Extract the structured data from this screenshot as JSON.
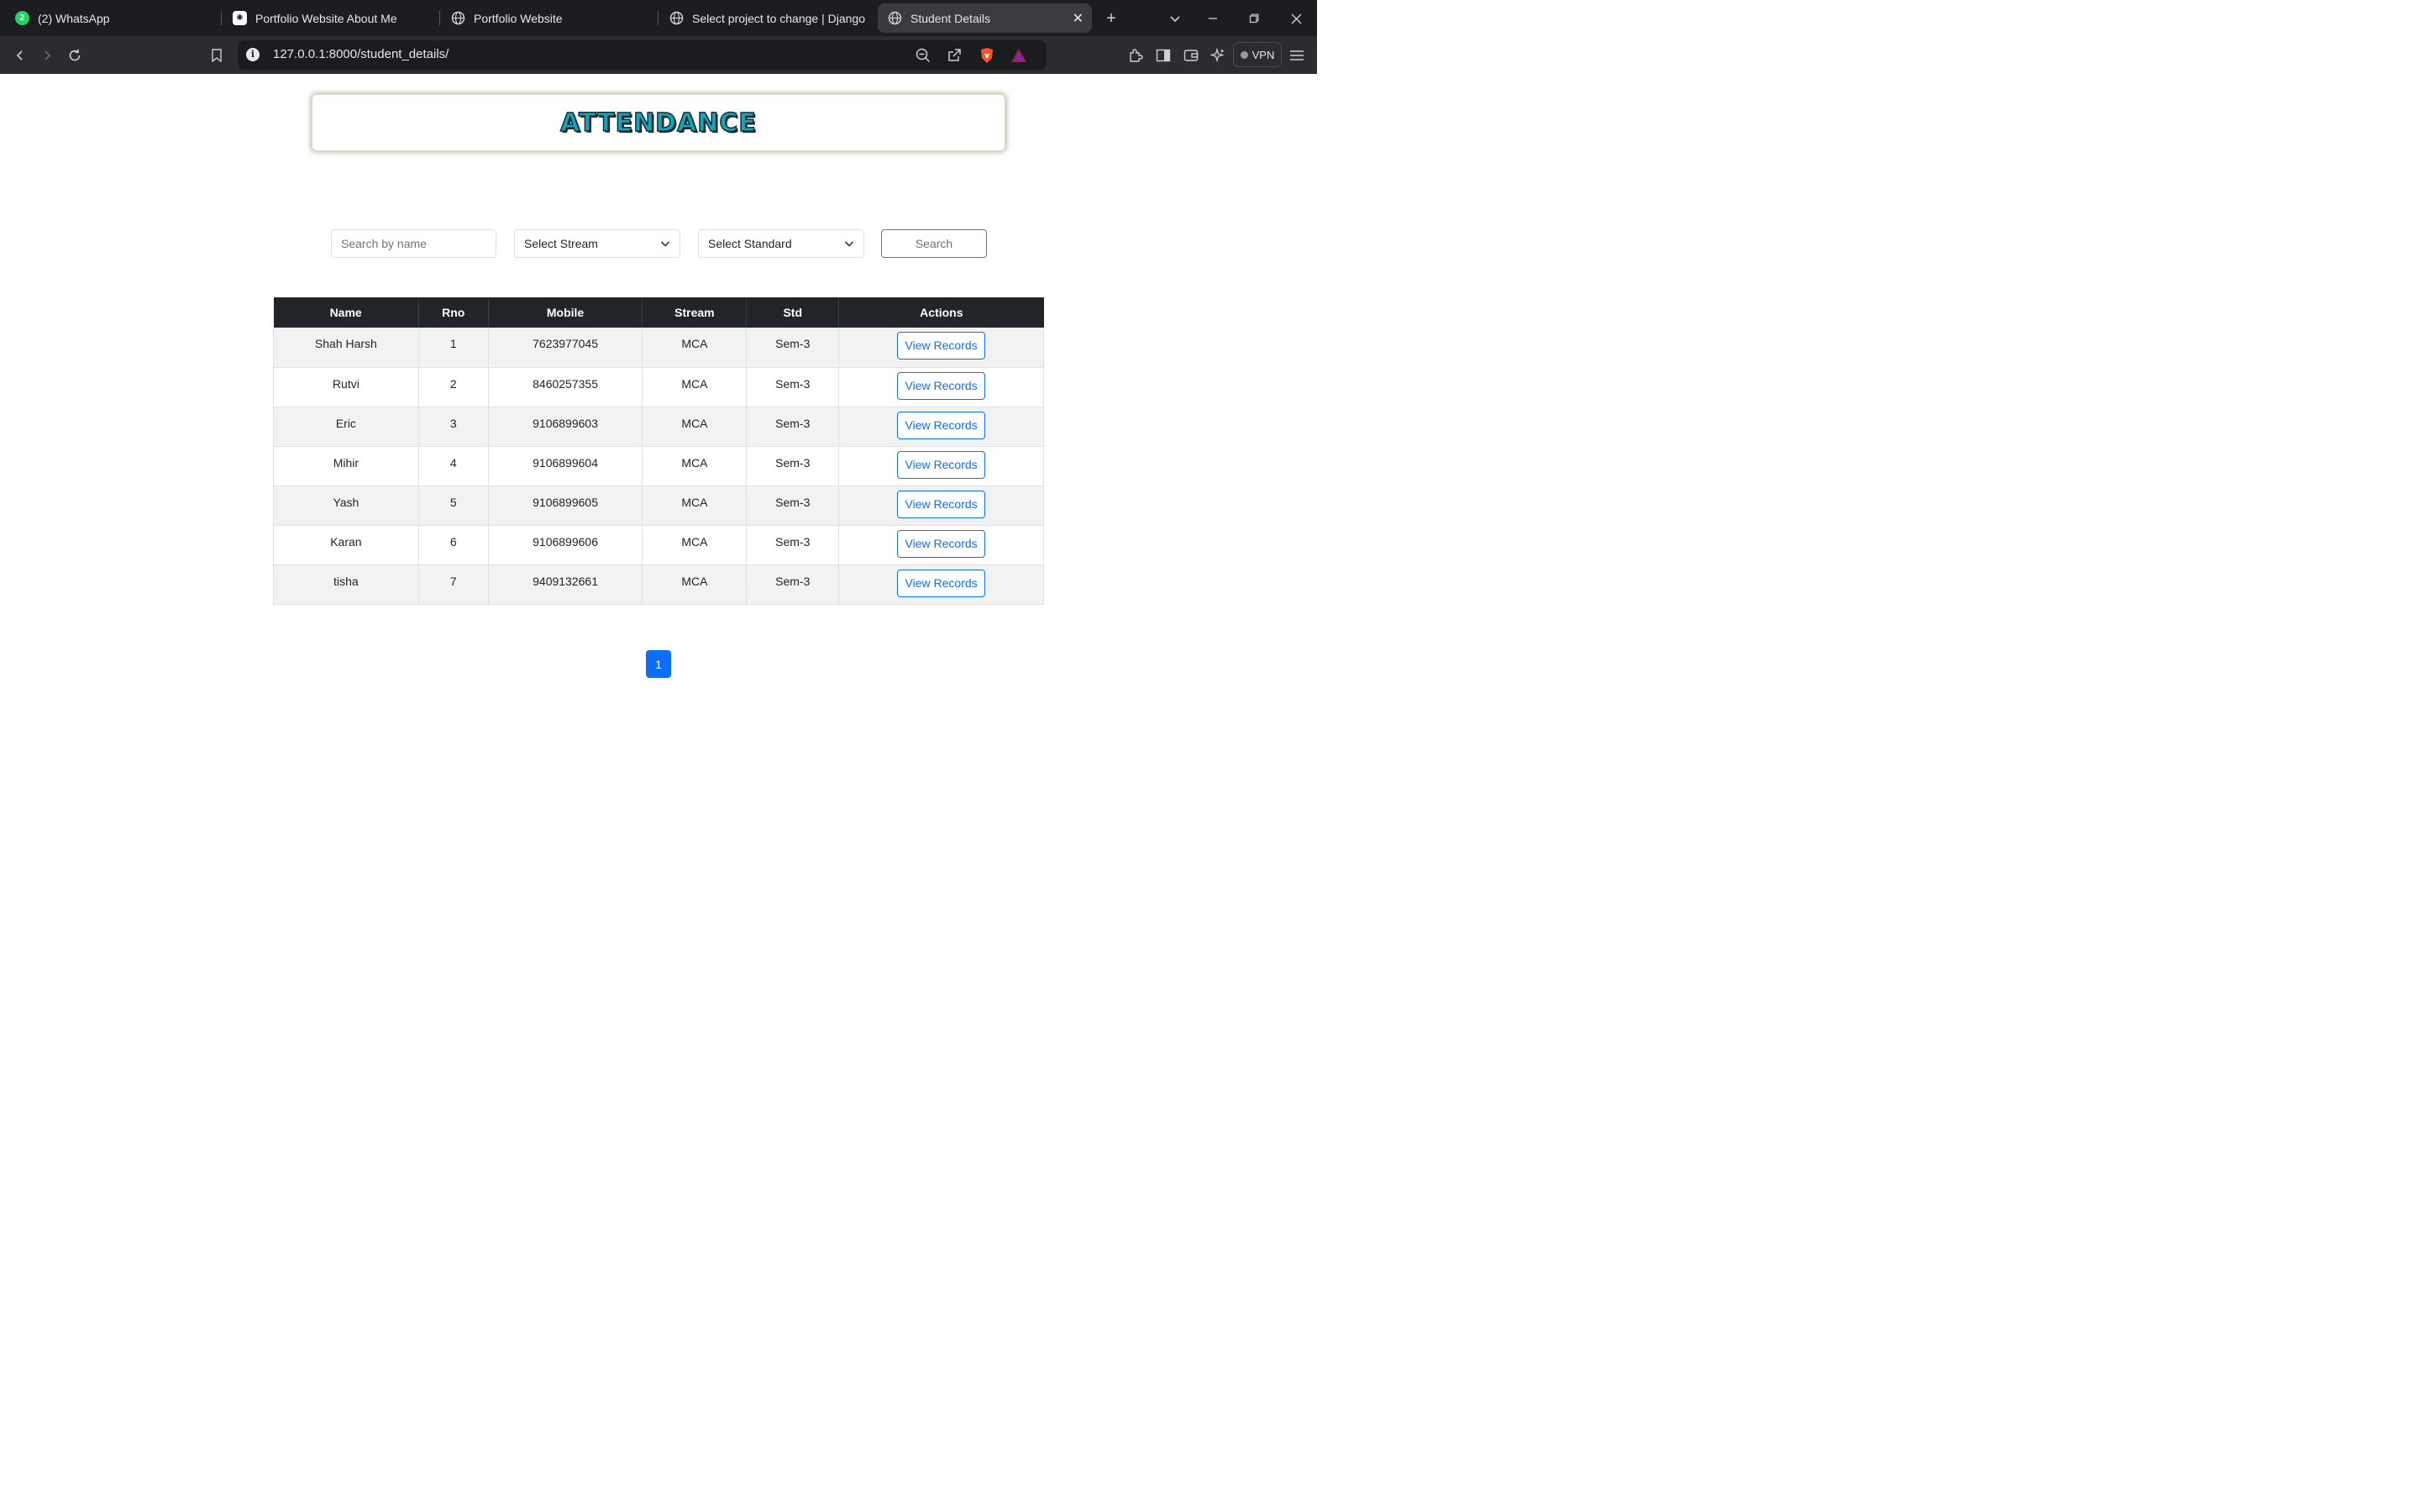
{
  "browser": {
    "tabs": [
      {
        "title": "(2) WhatsApp",
        "badge": "2",
        "icon": "whatsapp-icon"
      },
      {
        "title": "Portfolio Website About Me",
        "icon": "openai-icon"
      },
      {
        "title": "Portfolio Website",
        "icon": "globe-icon"
      },
      {
        "title": "Select project to change | Django sit",
        "icon": "globe-icon"
      },
      {
        "title": "Student Details",
        "icon": "globe-icon",
        "active": true
      }
    ],
    "url": "127.0.0.1:8000/student_details/",
    "vpn_label": "VPN"
  },
  "page": {
    "logo_text": "ATTENDANCE",
    "search": {
      "placeholder": "Search by name",
      "stream_label": "Select Stream",
      "standard_label": "Select Standard",
      "button_label": "Search"
    },
    "table": {
      "headers": [
        "Name",
        "Rno",
        "Mobile",
        "Stream",
        "Std",
        "Actions"
      ],
      "rows": [
        {
          "name": "Shah Harsh",
          "rno": "1",
          "mobile": "7623977045",
          "stream": "MCA",
          "std": "Sem-3",
          "action": "View Records"
        },
        {
          "name": "Rutvi",
          "rno": "2",
          "mobile": "8460257355",
          "stream": "MCA",
          "std": "Sem-3",
          "action": "View Records"
        },
        {
          "name": "Eric",
          "rno": "3",
          "mobile": "9106899603",
          "stream": "MCA",
          "std": "Sem-3",
          "action": "View Records"
        },
        {
          "name": "Mihir",
          "rno": "4",
          "mobile": "9106899604",
          "stream": "MCA",
          "std": "Sem-3",
          "action": "View Records"
        },
        {
          "name": "Yash",
          "rno": "5",
          "mobile": "9106899605",
          "stream": "MCA",
          "std": "Sem-3",
          "action": "View Records"
        },
        {
          "name": "Karan",
          "rno": "6",
          "mobile": "9106899606",
          "stream": "MCA",
          "std": "Sem-3",
          "action": "View Records"
        },
        {
          "name": "tisha",
          "rno": "7",
          "mobile": "9409132661",
          "stream": "MCA",
          "std": "Sem-3",
          "action": "View Records"
        }
      ]
    },
    "pagination": {
      "current": "1"
    }
  },
  "colors": {
    "header_bg": "#212529",
    "accent": "#0d6efd",
    "stripe": "#f2f2f2"
  }
}
